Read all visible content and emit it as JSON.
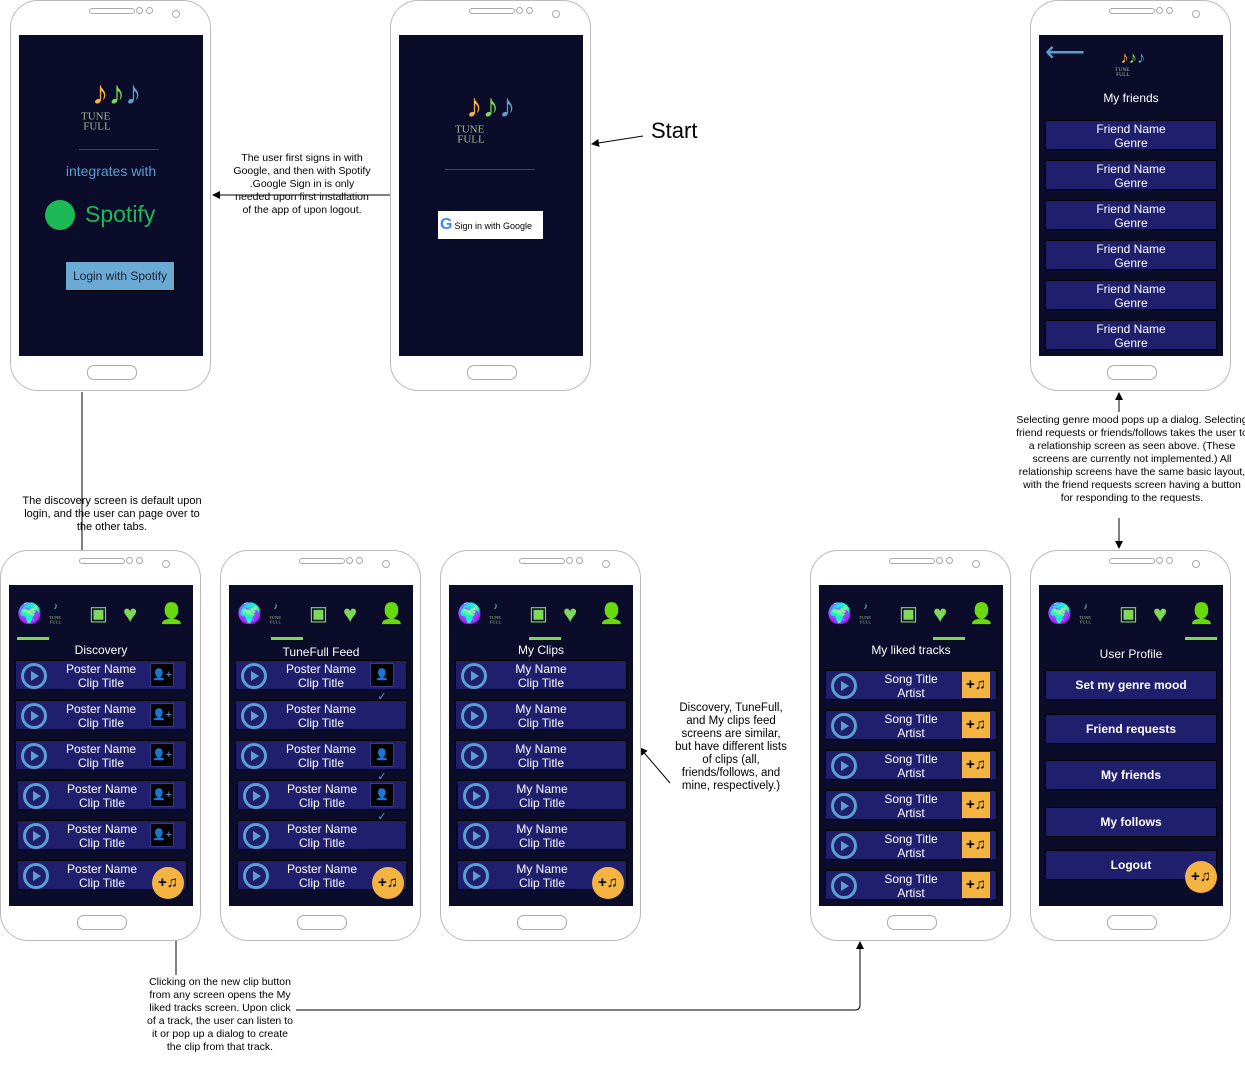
{
  "colors": {
    "screen": "#0b0b2a",
    "row": "#1f1f6e",
    "accent": "#7ed957",
    "play": "#5aa0d0",
    "fab": "#f5b342",
    "spotify": "#1db954"
  },
  "logo": {
    "line1": "TUNE",
    "line2": "FULL"
  },
  "nav_icons": [
    "globe-icon",
    "tunefull-logo-icon",
    "clips-icon",
    "heart-icon",
    "user-icon"
  ],
  "login": {
    "integrates": "integrates with",
    "spotify": "Spotify",
    "button": "Login with Spotify"
  },
  "start": {
    "google_button": "Sign in with Google",
    "label": "Start"
  },
  "friends": {
    "title": "My friends",
    "back_icon": "arrow-left-icon",
    "rows": [
      [
        "Friend Name",
        "Genre"
      ],
      [
        "Friend Name",
        "Genre"
      ],
      [
        "Friend Name",
        "Genre"
      ],
      [
        "Friend Name",
        "Genre"
      ],
      [
        "Friend Name",
        "Genre"
      ],
      [
        "Friend Name",
        "Genre"
      ]
    ]
  },
  "discovery": {
    "title": "Discovery",
    "rows": [
      [
        "Poster Name",
        "Clip Title",
        "add-user-icon"
      ],
      [
        "Poster Name",
        "Clip Title",
        "add-user-icon"
      ],
      [
        "Poster Name",
        "Clip Title",
        "add-user-icon"
      ],
      [
        "Poster Name",
        "Clip Title",
        "add-user-icon"
      ],
      [
        "Poster Name",
        "Clip Title",
        "add-user-icon"
      ],
      [
        "Poster Name",
        "Clip Title",
        ""
      ]
    ]
  },
  "feed": {
    "title": "TuneFull Feed",
    "rows": [
      [
        "Poster Name",
        "Clip Title",
        "check-user-icon"
      ],
      [
        "Poster Name",
        "Clip Title",
        ""
      ],
      [
        "Poster Name",
        "Clip Title",
        "check-user-icon"
      ],
      [
        "Poster Name",
        "Clip Title",
        "check-user-icon"
      ],
      [
        "Poster Name",
        "Clip Title",
        ""
      ],
      [
        "Poster Name",
        "Clip Title",
        ""
      ]
    ]
  },
  "clips": {
    "title": "My Clips",
    "rows": [
      [
        "My Name",
        "Clip Title",
        ""
      ],
      [
        "My Name",
        "Clip Title",
        ""
      ],
      [
        "My Name",
        "Clip Title",
        ""
      ],
      [
        "My Name",
        "Clip Title",
        ""
      ],
      [
        "My Name",
        "Clip Title",
        ""
      ],
      [
        "My Name",
        "Clip Title",
        ""
      ]
    ]
  },
  "liked": {
    "title": "My liked tracks",
    "rows": [
      [
        "Song Title",
        "Artist"
      ],
      [
        "Song Title",
        "Artist"
      ],
      [
        "Song Title",
        "Artist"
      ],
      [
        "Song Title",
        "Artist"
      ],
      [
        "Song Title",
        "Artist"
      ],
      [
        "Song Title",
        "Artist"
      ]
    ]
  },
  "profile": {
    "title": "User Profile",
    "buttons": [
      "Set my genre mood",
      "Friend requests",
      "My friends",
      "My follows",
      "Logout"
    ]
  },
  "fab_label": "+♫",
  "notes": {
    "signin": "The user first signs in with Google, and then with Spotify .Google Sign in is only needed upon first installation of the app of upon logout.",
    "discovery": "The discovery screen is default upon login, and the user can page over to the other tabs.",
    "feeds": "Discovery, TuneFull, and My clips feed screens are similar, but have different lists of clips (all, friends/follows, and mine, respectively.)",
    "newclip": "Clicking on the new clip button from any screen opens the My liked tracks screen. Upon click of a track, the user can listen to it or pop up a dialog to create the clip from that track.",
    "profile": "Selecting genre mood pops up a dialog. Selecting friend requests or friends/follows takes the user to a relationship screen as seen above. (These screens are currently not implemented.) All relationship screens have the same basic layout, with the friend requests screen having a button for responding to the requests."
  }
}
